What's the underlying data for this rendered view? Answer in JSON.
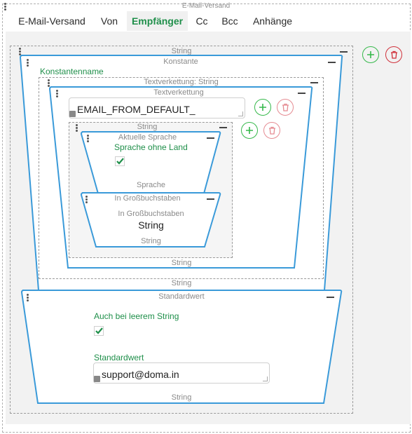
{
  "window": {
    "title": "E-Mail-Versand"
  },
  "tabs": [
    {
      "label": "E-Mail-Versand",
      "active": false
    },
    {
      "label": "Von",
      "active": false
    },
    {
      "label": "Empfänger",
      "active": true
    },
    {
      "label": "Cc",
      "active": false
    },
    {
      "label": "Bcc",
      "active": false
    },
    {
      "label": "Anhänge",
      "active": false
    }
  ],
  "colors": {
    "accent": "#1f8f4a",
    "block_border": "#3a9ad9",
    "add": "#35b84a",
    "delete": "#d0303a"
  },
  "icons": {
    "add": "plus-circle-icon",
    "delete": "trash-icon",
    "menu": "drag-dots-icon",
    "collapse": "minus-icon",
    "link": "link-icon"
  },
  "tree": {
    "outer_string": {
      "label": "String"
    },
    "konstante": {
      "label": "Konstante",
      "name_label": "Konstantenname"
    },
    "concat_string": {
      "label": "Textverkettung: String"
    },
    "concat": {
      "label": "Textverkettung",
      "value": "EMAIL_FROM_DEFAULT_"
    },
    "sub_string": {
      "label": "String"
    },
    "language": {
      "label": "Aktuelle Sprache",
      "option_label": "Sprache ohne Land",
      "option_checked": true,
      "footer": "Sprache"
    },
    "uppercase": {
      "label": "In Großbuchstaben",
      "inner_label": "In Großbuchstaben",
      "inner_value": "String",
      "footer": "String"
    },
    "concat_footer": "String",
    "konstante_footer": "String",
    "default": {
      "label": "Standardwert",
      "empty_label": "Auch bei leerem String",
      "empty_checked": true,
      "value_label": "Standardwert",
      "value": "support@doma.in",
      "footer": "String"
    }
  }
}
